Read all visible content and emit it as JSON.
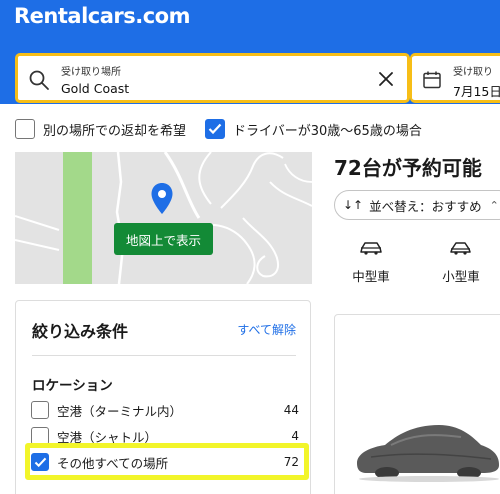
{
  "header": {
    "logo": "Rentalcars.com",
    "brand_color": "#1e6ee6"
  },
  "search": {
    "pickup_label": "受け取り場所",
    "pickup_value": "Gold Coast",
    "date_label": "受け取り",
    "date_value": "7月15日"
  },
  "options": {
    "return_other": {
      "label": "別の場所での返却を希望",
      "checked": false
    },
    "driver_age": {
      "label": "ドライバーが30歳〜65歳の場合",
      "checked": true
    }
  },
  "map": {
    "button_label": "地図上で表示"
  },
  "results": {
    "title": "72台が予約可能",
    "sort_label": "並べ替え：おすすめ"
  },
  "categories": [
    {
      "label": "中型車",
      "icon": "car-icon"
    },
    {
      "label": "小型車",
      "icon": "car-icon"
    }
  ],
  "filters": {
    "title": "絞り込み条件",
    "clear_all": "すべて解除",
    "location_section": "ロケーション",
    "items": [
      {
        "label": "空港（ターミナル内）",
        "count": "44",
        "checked": false
      },
      {
        "label": "空港（シャトル）",
        "count": "4",
        "checked": false
      },
      {
        "label": "その他すべての場所",
        "count": "72",
        "checked": true
      }
    ]
  },
  "colors": {
    "accent": "#1e6ee6",
    "search_border": "#f7be17",
    "map_button": "#138a36",
    "highlight": "#f2f52a"
  }
}
